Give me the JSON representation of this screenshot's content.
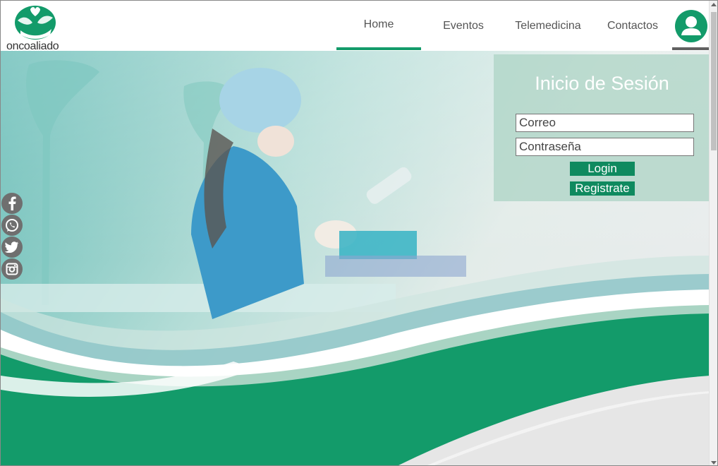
{
  "brand": {
    "name": "oncoaliado",
    "icon": "hands-heart-logo",
    "color": "#139b6a"
  },
  "nav": {
    "items": [
      {
        "label": "Home",
        "active": true
      },
      {
        "label": "Eventos",
        "active": false
      },
      {
        "label": "Telemedicina",
        "active": false
      },
      {
        "label": "Contactos",
        "active": false
      }
    ],
    "account_icon": "user-icon"
  },
  "social": [
    "facebook-icon",
    "whatsapp-icon",
    "twitter-icon",
    "instagram-icon"
  ],
  "login": {
    "title": "Inicio de Sesión",
    "email_placeholder": "Correo",
    "password_placeholder": "Contraseña",
    "login_label": "Login",
    "register_label": "Registrate"
  },
  "colors": {
    "accent": "#139b6a",
    "button": "#0f8a5f",
    "panel": "#aad2c3"
  }
}
